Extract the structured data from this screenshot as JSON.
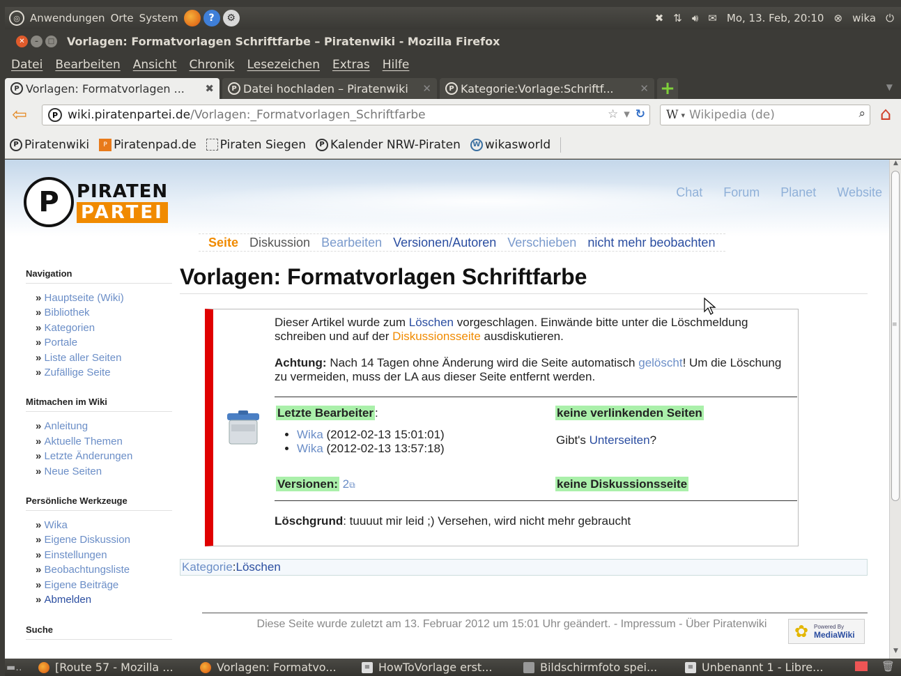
{
  "top_panel": {
    "menus": [
      "Anwendungen",
      "Orte",
      "System"
    ],
    "datetime": "Mo, 13. Feb, 20:10",
    "user": "wika"
  },
  "window": {
    "title": "Vorlagen: Formatvorlagen Schriftfarbe – Piratenwiki - Mozilla Firefox"
  },
  "menubar": [
    "Datei",
    "Bearbeiten",
    "Ansicht",
    "Chronik",
    "Lesezeichen",
    "Extras",
    "Hilfe"
  ],
  "tabs": [
    {
      "label": "Vorlagen: Formatvorlagen ..."
    },
    {
      "label": "Datei hochladen – Piratenwiki"
    },
    {
      "label": "Kategorie:Vorlage:Schriftf..."
    }
  ],
  "navbar": {
    "url_domain": "wiki.piratenpartei.de",
    "url_path": "/Vorlagen:_Formatvorlagen_Schriftfarbe",
    "search_engine": "W",
    "search_placeholder": "Wikipedia (de)"
  },
  "bookmarks": [
    "Piratenwiki",
    "Piratenpad.de",
    "Piraten Siegen",
    "Kalender NRW-Piraten",
    "wikasworld"
  ],
  "page": {
    "logo_top": "PIRATEN",
    "logo_bottom": "PARTEI",
    "top_links": [
      "Chat",
      "Forum",
      "Planet",
      "Website"
    ],
    "actions": {
      "seite": "Seite",
      "diskussion": "Diskussion",
      "bearbeiten": "Bearbeiten",
      "versionen": "Versionen/Autoren",
      "verschieben": "Verschieben",
      "beobachten": "nicht mehr beobachten"
    },
    "title": "Vorlagen: Formatvorlagen Schriftfarbe",
    "sidebar": {
      "navigation": {
        "heading": "Navigation",
        "items": [
          "Hauptseite (Wiki)",
          "Bibliothek",
          "Kategorien",
          "Portale",
          "Liste aller Seiten",
          "Zufällige Seite"
        ]
      },
      "mitmachen": {
        "heading": "Mitmachen im Wiki",
        "items": [
          "Anleitung",
          "Aktuelle Themen",
          "Letzte Änderungen",
          "Neue Seiten"
        ]
      },
      "werkzeuge": {
        "heading": "Persönliche Werkzeuge",
        "items": [
          "Wika",
          "Eigene Diskussion",
          "Einstellungen",
          "Beobachtungsliste",
          "Eigene Beiträge",
          "Abmelden"
        ]
      },
      "suche": {
        "heading": "Suche"
      }
    },
    "notice": {
      "p1_a": "Dieser Artikel wurde zum ",
      "p1_link1": "Löschen",
      "p1_b": " vorgeschlagen. Einwände bitte unter die Löschmeldung schreiben und auf der ",
      "p1_link2": "Diskussionsseite",
      "p1_c": " ausdiskutieren.",
      "p2_bold": "Achtung:",
      "p2_a": " Nach 14 Tagen ohne Änderung wird die Seite automatisch ",
      "p2_link": "gelöscht",
      "p2_b": "! Um die Löschung zu vermeiden, muss der LA aus dieser Seite entfernt werden.",
      "letzte_bearbeiter": "Letzte Bearbeiter",
      "editors": [
        {
          "name": "Wika",
          "time": "(2012-02-13 15:01:01)"
        },
        {
          "name": "Wika",
          "time": "(2012-02-13 13:57:18)"
        }
      ],
      "keine_verlinkenden": "keine verlinkenden Seiten",
      "gibts": "Gibt's ",
      "unterseiten": "Unterseiten",
      "unterseiten_q": "?",
      "versionen_label": "Versionen:",
      "versionen_count": "2",
      "keine_diskussion": "keine Diskussionsseite",
      "loeschgrund_label": "Löschgrund",
      "loeschgrund_text": ": tuuuut mir leid ;) Versehen, wird nicht mehr gebraucht"
    },
    "kategorie_label": "Kategorie",
    "kategorie_value": "Löschen",
    "footer": "Diese Seite wurde zuletzt am 13. Februar 2012 um 15:01 Uhr geändert. - Impressum - Über Piratenwiki",
    "mediawiki_powered": "Powered By",
    "mediawiki_name": "MediaWiki"
  },
  "taskbar": [
    "[Route 57 - Mozilla ...",
    "Vorlagen: Formatvo...",
    "HowToVorlage erst...",
    "Bildschirmfoto spei...",
    "Unbenannt 1 - Libre..."
  ],
  "colors": {
    "accent_orange": "#f08a00",
    "notice_red": "#e00000",
    "highlight_green": "#aaf0aa",
    "link_blue": "#6b8ec7"
  }
}
